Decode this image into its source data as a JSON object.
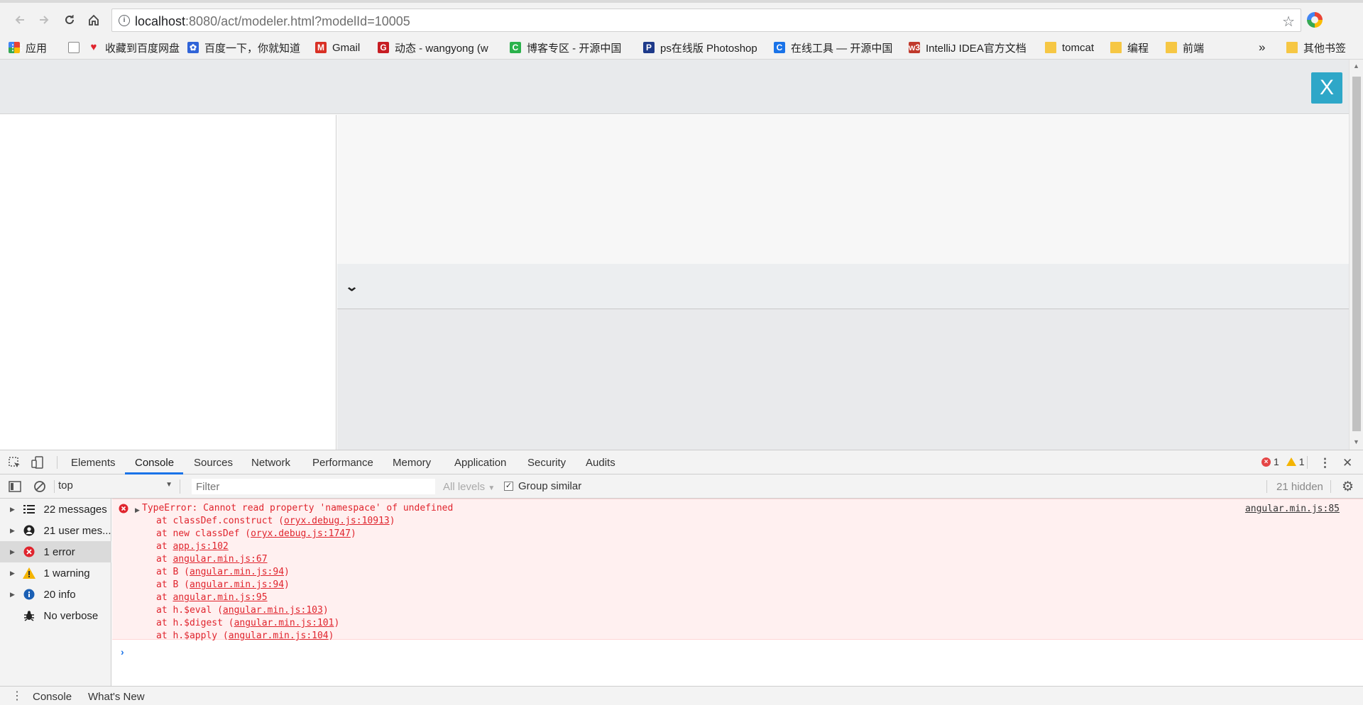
{
  "browser": {
    "url_host": "localhost",
    "url_rest": ":8080/act/modeler.html?modelId=10005",
    "bookmarks": [
      {
        "label": "应用",
        "icon": "apps-grid-icon",
        "color": "#e94235"
      },
      {
        "label": "",
        "icon": "page-icon",
        "color": "#888888"
      },
      {
        "label": "收藏到百度网盘",
        "icon": "heart-icon",
        "color": "#e0242d"
      },
      {
        "label": "百度一下，你就知道",
        "icon": "baidu-paw-icon",
        "color": "#3064d8"
      },
      {
        "label": "Gmail",
        "icon": "gmail-icon",
        "color": "#d93025"
      },
      {
        "label": "动态 - wangyong (w",
        "icon": "gitee-icon",
        "color": "#c71d23"
      },
      {
        "label": "博客专区 - 开源中国",
        "icon": "oschina-icon",
        "color": "#2bb24c"
      },
      {
        "label": "ps在线版 Photoshop",
        "icon": "ps-icon",
        "color": "#1e3a8a"
      },
      {
        "label": "在线工具 — 开源中国",
        "icon": "tool-icon",
        "color": "#1a73e8"
      },
      {
        "label": "IntelliJ IDEA官方文档",
        "icon": "w3c-icon",
        "color": "#c0392b"
      },
      {
        "label": "tomcat",
        "icon": "folder-icon",
        "color": "#f6c744"
      },
      {
        "label": "编程",
        "icon": "folder-icon",
        "color": "#f6c744"
      },
      {
        "label": "前端",
        "icon": "folder-icon",
        "color": "#f6c744"
      }
    ],
    "overflow_chevron": "»",
    "other_bookmarks": "其他书签"
  },
  "page": {
    "close_label": "X"
  },
  "devtools": {
    "tabs": [
      "Elements",
      "Console",
      "Sources",
      "Network",
      "Performance",
      "Memory",
      "Application",
      "Security",
      "Audits"
    ],
    "active_tab": "Console",
    "error_count": "1",
    "warning_count": "1",
    "context": "top",
    "filter_placeholder": "Filter",
    "levels_label": "All levels",
    "group_similar_label": "Group similar",
    "hidden_label": "21 hidden",
    "sidebar": [
      {
        "label": "22 messages",
        "icon": "list-icon"
      },
      {
        "label": "21 user mes...",
        "icon": "user-icon"
      },
      {
        "label": "1 error",
        "icon": "error-icon"
      },
      {
        "label": "1 warning",
        "icon": "warning-icon"
      },
      {
        "label": "20 info",
        "icon": "info-icon"
      },
      {
        "label": "No verbose",
        "icon": "bug-icon"
      }
    ],
    "error": {
      "message": "TypeError: Cannot read property 'namespace' of undefined",
      "source": "angular.min.js:85",
      "stack": [
        {
          "prefix": "at classDef.construct (",
          "link": "oryx.debug.js:10913",
          "suffix": ")"
        },
        {
          "prefix": "at new classDef (",
          "link": "oryx.debug.js:1747",
          "suffix": ")"
        },
        {
          "prefix": "at ",
          "link": "app.js:102",
          "suffix": ""
        },
        {
          "prefix": "at ",
          "link": "angular.min.js:67",
          "suffix": ""
        },
        {
          "prefix": "at B (",
          "link": "angular.min.js:94",
          "suffix": ")"
        },
        {
          "prefix": "at B (",
          "link": "angular.min.js:94",
          "suffix": ")"
        },
        {
          "prefix": "at ",
          "link": "angular.min.js:95",
          "suffix": ""
        },
        {
          "prefix": "at h.$eval (",
          "link": "angular.min.js:103",
          "suffix": ")"
        },
        {
          "prefix": "at h.$digest (",
          "link": "angular.min.js:101",
          "suffix": ")"
        },
        {
          "prefix": "at h.$apply (",
          "link": "angular.min.js:104",
          "suffix": ")"
        }
      ]
    },
    "prompt_symbol": "›",
    "drawer_tabs": [
      "Console",
      "What's New"
    ]
  }
}
